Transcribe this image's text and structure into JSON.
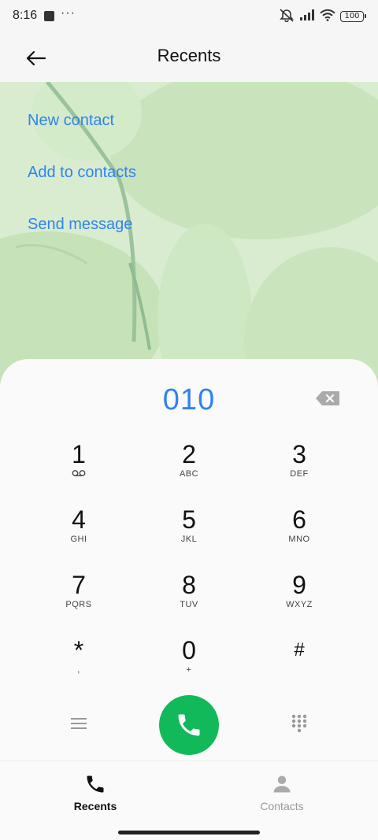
{
  "status_bar": {
    "time": "8:16",
    "overflow_dots": "···",
    "battery": "100"
  },
  "header": {
    "title": "Recents",
    "back_icon": "arrow-left-icon"
  },
  "actions": [
    {
      "label": "New contact"
    },
    {
      "label": "Add to contacts"
    },
    {
      "label": "Send message"
    }
  ],
  "dialer": {
    "number": "010",
    "accent_color": "#2f83f0",
    "call_color": "#12b95a",
    "keys": [
      {
        "digit": "1",
        "letters": ""
      },
      {
        "digit": "2",
        "letters": "ABC"
      },
      {
        "digit": "3",
        "letters": "DEF"
      },
      {
        "digit": "4",
        "letters": "GHI"
      },
      {
        "digit": "5",
        "letters": "JKL"
      },
      {
        "digit": "6",
        "letters": "MNO"
      },
      {
        "digit": "7",
        "letters": "PQRS"
      },
      {
        "digit": "8",
        "letters": "TUV"
      },
      {
        "digit": "9",
        "letters": "WXYZ"
      },
      {
        "digit": "*",
        "letters": ","
      },
      {
        "digit": "0",
        "letters": "+"
      },
      {
        "digit": "#",
        "letters": ""
      }
    ]
  },
  "bottom_nav": {
    "items": [
      {
        "label": "Recents",
        "icon": "phone-icon",
        "active": true
      },
      {
        "label": "Contacts",
        "icon": "person-icon",
        "active": false
      }
    ]
  }
}
